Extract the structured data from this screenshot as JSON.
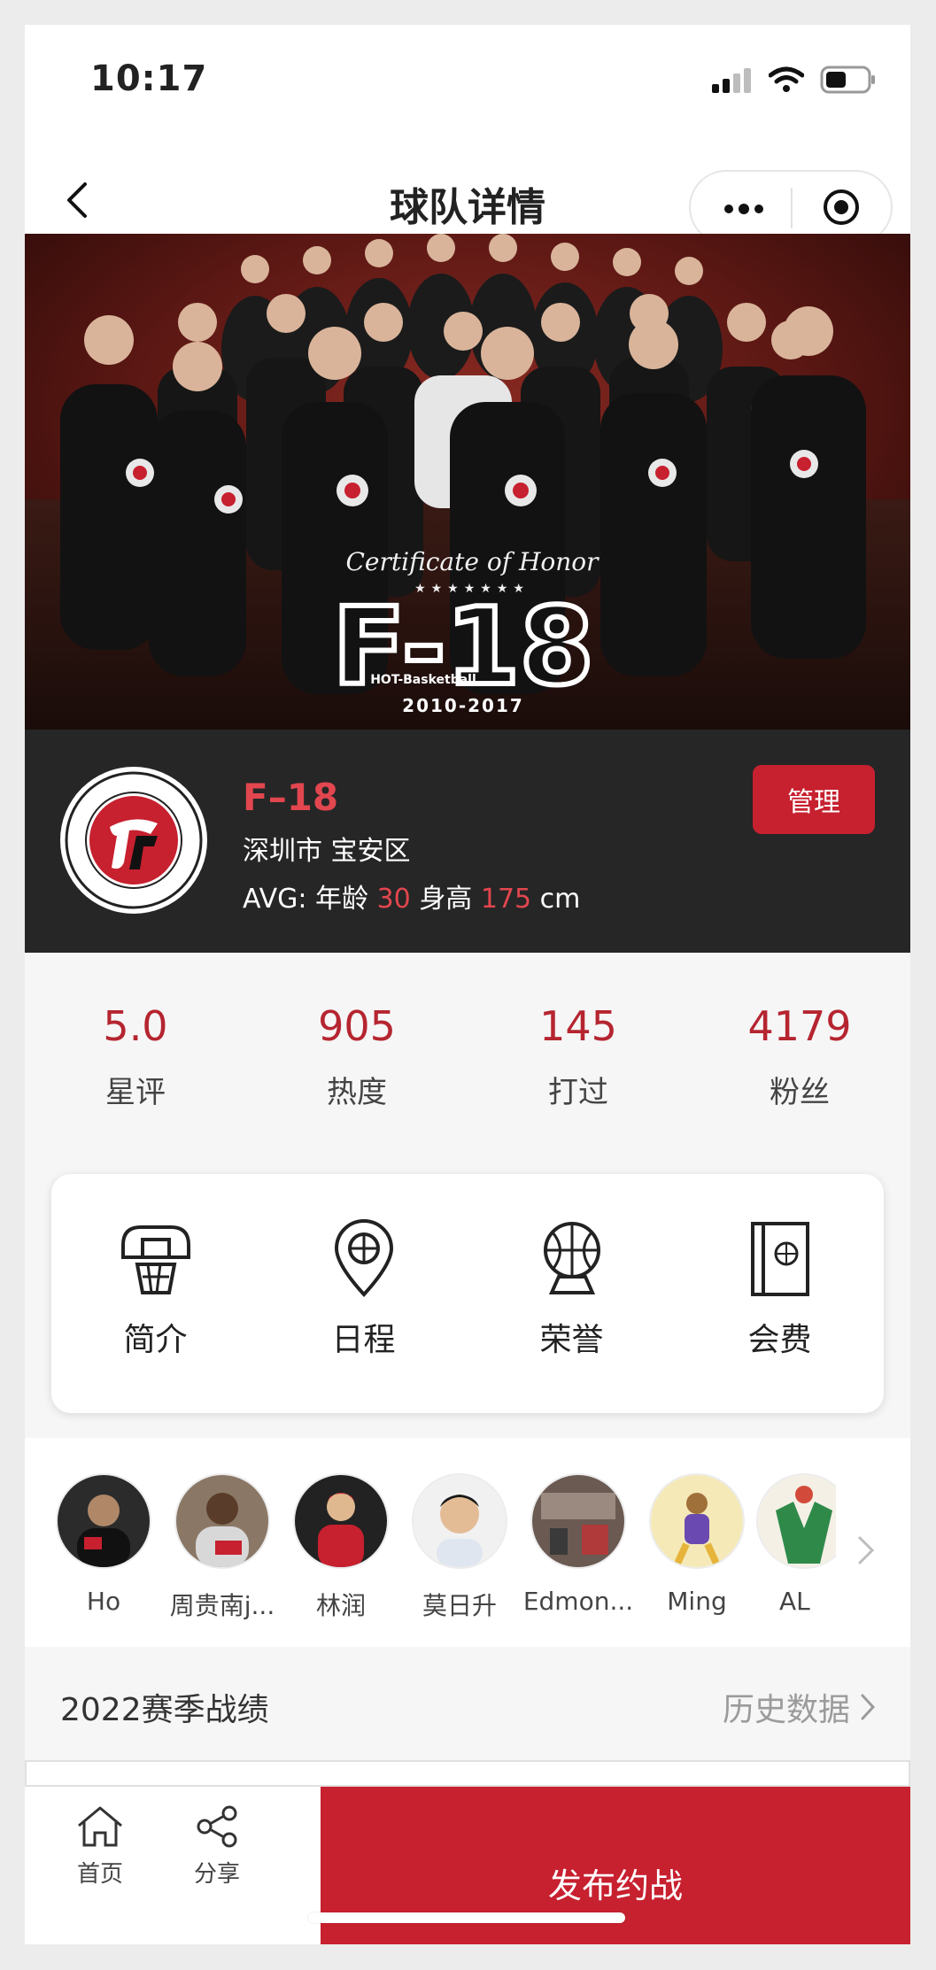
{
  "status_bar": {
    "time": "10:17"
  },
  "nav": {
    "title": "球队详情"
  },
  "banner": {
    "certificate": "Certificate of Honor",
    "stars": "★★★★★★★",
    "team_mark": "F-18",
    "brand": "HOT-Basketball",
    "years": "2010-2017"
  },
  "team": {
    "name": "F–18",
    "location": "深圳市 宝安区",
    "avg_prefix": "AVG: 年龄",
    "age": "30",
    "height_label": "身高",
    "height": "175",
    "unit": "cm",
    "manage_label": "管理"
  },
  "stats": [
    {
      "value": "5.0",
      "label": "星评"
    },
    {
      "value": "905",
      "label": "热度"
    },
    {
      "value": "145",
      "label": "打过"
    },
    {
      "value": "4179",
      "label": "粉丝"
    }
  ],
  "menu": [
    {
      "label": "简介",
      "icon": "basketball-hoop-icon"
    },
    {
      "label": "日程",
      "icon": "location-pin-icon"
    },
    {
      "label": "荣誉",
      "icon": "trophy-icon"
    },
    {
      "label": "会费",
      "icon": "wallet-icon"
    }
  ],
  "members": [
    {
      "name": "Ho"
    },
    {
      "name": "周贵南j..."
    },
    {
      "name": "林润"
    },
    {
      "name": "莫日升"
    },
    {
      "name": "Edmon..."
    },
    {
      "name": "Ming"
    },
    {
      "name": "AL"
    }
  ],
  "season": {
    "title": "2022赛季战绩",
    "history_link": "历史数据"
  },
  "tabbar": {
    "home": "首页",
    "share": "分享",
    "publish": "发布约战"
  },
  "colors": {
    "accent": "#c7202f",
    "highlight": "#e2464e",
    "dark_card": "#262627"
  }
}
